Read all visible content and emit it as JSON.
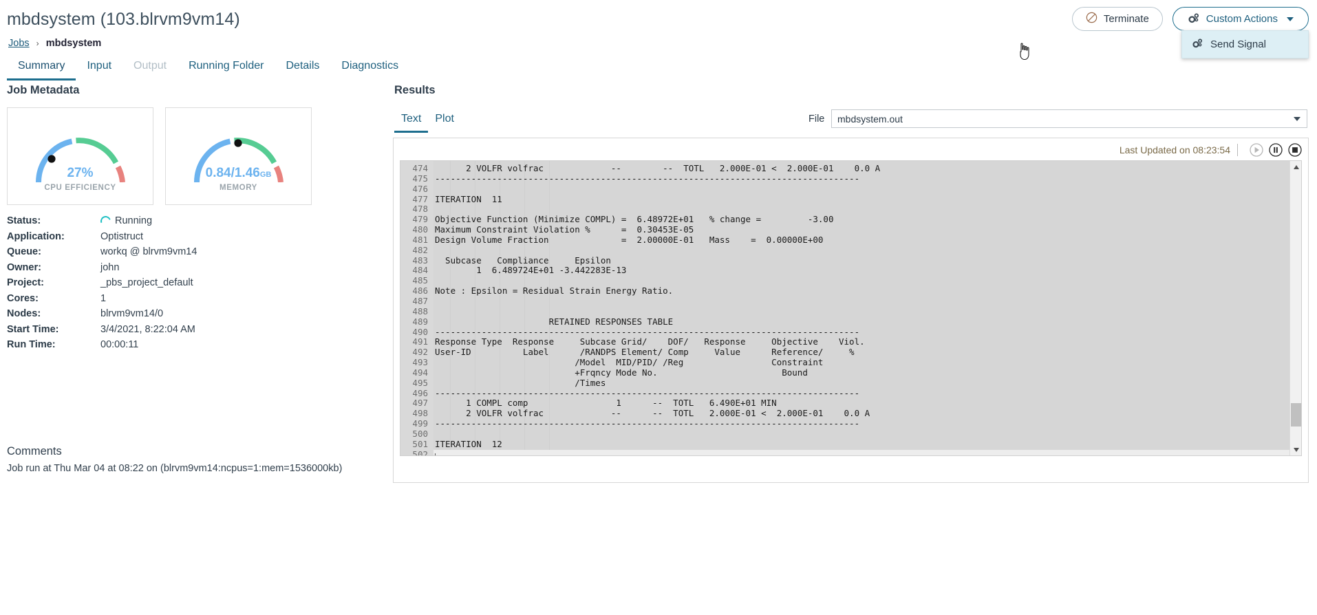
{
  "header": {
    "title": "mbdsystem (103.blrvm9vm14)",
    "breadcrumb": {
      "root": "Jobs",
      "separator": "›",
      "current": "mbdsystem"
    },
    "terminate_label": "Terminate",
    "terminate_icon": "no-entry-icon",
    "custom_actions_label": "Custom Actions",
    "custom_actions_icon": "gears-icon",
    "dropdown": {
      "items": [
        {
          "label": "Send Signal",
          "icon": "gears-icon"
        }
      ]
    }
  },
  "tabs": [
    {
      "label": "Summary",
      "state": "active"
    },
    {
      "label": "Input",
      "state": "enabled"
    },
    {
      "label": "Output",
      "state": "disabled"
    },
    {
      "label": "Running Folder",
      "state": "enabled"
    },
    {
      "label": "Details",
      "state": "enabled"
    },
    {
      "label": "Diagnostics",
      "state": "enabled"
    }
  ],
  "left": {
    "heading": "Job Metadata",
    "gauges": [
      {
        "value": "27%",
        "unit": "",
        "label": "CPU EFFICIENCY",
        "percent": 27,
        "color": "#6cb3ef",
        "arc_green": "#56cc93",
        "arc_red": "#e8827e"
      },
      {
        "value": "0.84/1.46",
        "unit": "GB",
        "label": "MEMORY",
        "percent": 58,
        "color": "#6cb3ef",
        "arc_green": "#56cc93",
        "arc_red": "#e8827e"
      }
    ],
    "metadata": [
      {
        "key": "Status:",
        "value": "Running",
        "icon": "spinner-icon"
      },
      {
        "key": "Application:",
        "value": "Optistruct"
      },
      {
        "key": "Queue:",
        "value": "workq @ blrvm9vm14"
      },
      {
        "key": "Owner:",
        "value": "john"
      },
      {
        "key": "Project:",
        "value": "_pbs_project_default"
      },
      {
        "key": "Cores:",
        "value": "1"
      },
      {
        "key": "Nodes:",
        "value": "blrvm9vm14/0"
      },
      {
        "key": "Start Time:",
        "value": "3/4/2021, 8:22:04 AM"
      },
      {
        "key": "Run Time:",
        "value": "00:00:11"
      }
    ],
    "comments_heading": "Comments",
    "comments_body": "Job run at Thu Mar 04 at 08:22 on (blrvm9vm14:ncpus=1:mem=1536000kb)"
  },
  "results": {
    "heading": "Results",
    "tabs": [
      {
        "label": "Text",
        "state": "active"
      },
      {
        "label": "Plot",
        "state": "enabled"
      }
    ],
    "file_label": "File",
    "file_value": "mbdsystem.out",
    "last_updated": "Last Updated on 08:23:54",
    "controls": [
      {
        "name": "play-icon",
        "label": "Play"
      },
      {
        "name": "pause-icon",
        "label": "Pause"
      },
      {
        "name": "stop-icon",
        "label": "Stop"
      }
    ],
    "first_line_number": 474,
    "log_lines": [
      "      2 VOLFR volfrac             --        --  TOTL   2.000E-01 <  2.000E-01    0.0 A",
      "----------------------------------------------------------------------------------",
      "",
      "ITERATION  11",
      "",
      "Objective Function (Minimize COMPL) =  6.48972E+01   % change =         -3.00",
      "Maximum Constraint Violation %      =  0.30453E-05",
      "Design Volume Fraction              =  2.00000E-01   Mass    =  0.00000E+00",
      "",
      "  Subcase   Compliance     Epsilon",
      "        1  6.489724E+01 -3.442283E-13",
      "",
      "Note : Epsilon = Residual Strain Energy Ratio.",
      "",
      "",
      "                      RETAINED RESPONSES TABLE",
      "----------------------------------------------------------------------------------",
      "Response Type  Response     Subcase Grid/    DOF/   Response     Objective    Viol.",
      "User-ID          Label      /RANDPS Element/ Comp     Value      Reference/     %",
      "                           /Model  MID/PID/ /Reg                 Constraint",
      "                           +Frqncy Mode No.                        Bound",
      "                           /Times",
      "----------------------------------------------------------------------------------",
      "      1 COMPL comp                 1      --  TOTL   6.490E+01 MIN",
      "      2 VOLFR volfrac             --      --  TOTL   2.000E-01 <  2.000E-01    0.0 A",
      "----------------------------------------------------------------------------------",
      "",
      "ITERATION  12",
      ""
    ]
  }
}
